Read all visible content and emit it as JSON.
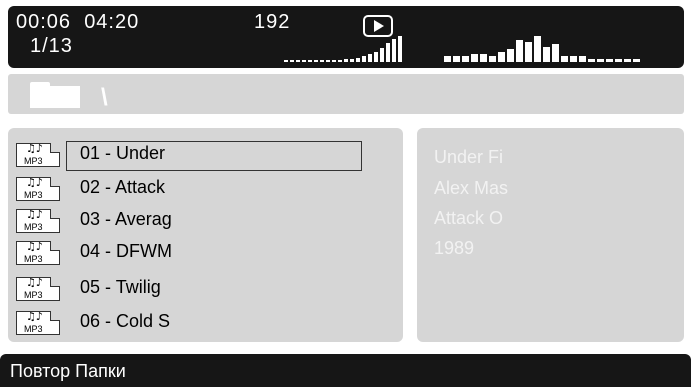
{
  "header": {
    "elapsed_time": "00:06",
    "total_time": "04:20",
    "track_position": "1/13",
    "bitrate": "192",
    "play_state": "play-icon",
    "vu_left_levels": [
      0.06,
      0.06,
      0.06,
      0.06,
      0.06,
      0.06,
      0.06,
      0.06,
      0.06,
      0.08,
      0.1,
      0.12,
      0.16,
      0.22,
      0.3,
      0.4,
      0.55,
      0.72,
      0.9,
      1.0
    ],
    "vu_right_levels": [
      0.22,
      0.22,
      0.22,
      0.3,
      0.3,
      0.22,
      0.38,
      0.5,
      0.85,
      0.78,
      1.0,
      0.58,
      0.7,
      0.22,
      0.22,
      0.22,
      0.12,
      0.12,
      0.12,
      0.12,
      0.12,
      0.12
    ]
  },
  "path": {
    "icon": "folder-icon",
    "current_path": "\\"
  },
  "tracks": [
    {
      "name": "01 - Under",
      "icon": "mp3-file-icon",
      "format": "MP3",
      "selected": true
    },
    {
      "name": "02 - Attack",
      "icon": "mp3-file-icon",
      "format": "MP3",
      "selected": false
    },
    {
      "name": "03 - Averag",
      "icon": "mp3-file-icon",
      "format": "MP3",
      "selected": false
    },
    {
      "name": "04 - DFWM",
      "icon": "mp3-file-icon",
      "format": "MP3",
      "selected": false
    },
    {
      "name": "05 - Twilig",
      "icon": "mp3-file-icon",
      "format": "MP3",
      "selected": false
    },
    {
      "name": "06 - Cold S",
      "icon": "mp3-file-icon",
      "format": "MP3",
      "selected": false
    }
  ],
  "info": {
    "title": "Under Fi",
    "artist": "Alex Mas",
    "album": "Attack O",
    "year": "1989"
  },
  "status": {
    "repeat_mode": "Повтор Папки"
  },
  "colors": {
    "dark_bar": "#161616",
    "panel": "#d6d6d6",
    "text_light": "#ffffff"
  }
}
